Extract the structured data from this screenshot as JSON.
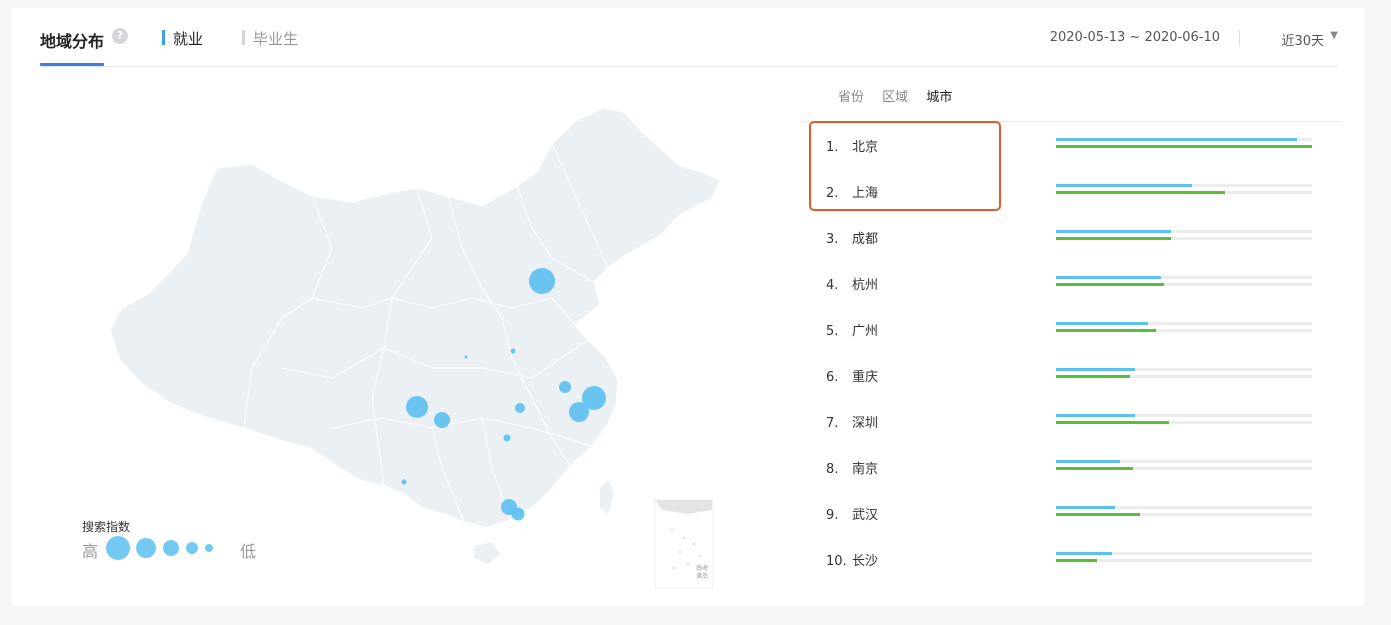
{
  "header": {
    "title": "地域分布",
    "help_icon": "?",
    "tab_employment": "就业",
    "tab_graduates": "毕业生",
    "date_range": "2020-05-13 ~ 2020-06-10",
    "period": "近30天",
    "period_icon": "chevron-down-icon"
  },
  "map": {
    "legend_title": "搜索指数",
    "legend_high": "高",
    "legend_low": "低",
    "inset_label_1": "南海",
    "inset_label_2": "诸岛"
  },
  "ranking": {
    "subtabs": [
      "省份",
      "区域",
      "城市"
    ],
    "active_subtab": "城市",
    "rows": [
      {
        "num": "1.",
        "city": "北京",
        "blue": 0.94,
        "green": 1.0
      },
      {
        "num": "2.",
        "city": "上海",
        "blue": 0.53,
        "green": 0.66
      },
      {
        "num": "3.",
        "city": "成都",
        "blue": 0.45,
        "green": 0.45
      },
      {
        "num": "4.",
        "city": "杭州",
        "blue": 0.41,
        "green": 0.42
      },
      {
        "num": "5.",
        "city": "广州",
        "blue": 0.36,
        "green": 0.39
      },
      {
        "num": "6.",
        "city": "重庆",
        "blue": 0.31,
        "green": 0.29
      },
      {
        "num": "7.",
        "city": "深圳",
        "blue": 0.31,
        "green": 0.44
      },
      {
        "num": "8.",
        "city": "南京",
        "blue": 0.25,
        "green": 0.3
      },
      {
        "num": "9.",
        "city": "武汉",
        "blue": 0.23,
        "green": 0.33
      },
      {
        "num": "10.",
        "city": "长沙",
        "blue": 0.22,
        "green": 0.16
      }
    ],
    "colors": {
      "blue": "#5ec0ee",
      "green": "#5cbf3b",
      "highlight": "#e05a2b"
    }
  }
}
